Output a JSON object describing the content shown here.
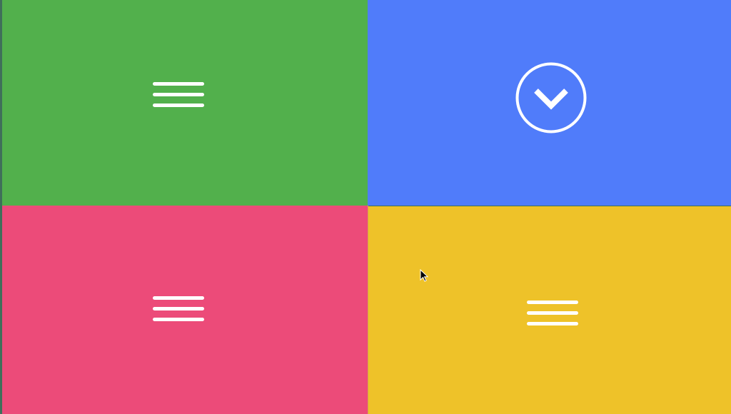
{
  "tiles": [
    {
      "id": "top-left",
      "color": "#52b04c",
      "icon": "hamburger-menu-icon"
    },
    {
      "id": "top-right",
      "color": "#507cfa",
      "icon": "chevron-down-circle-icon"
    },
    {
      "id": "bottom-left",
      "color": "#ec4b79",
      "icon": "hamburger-menu-icon"
    },
    {
      "id": "bottom-right",
      "color": "#eec229",
      "icon": "hamburger-menu-icon"
    }
  ],
  "icon_color": "#ffffff",
  "cursor": {
    "icon": "mouse-pointer-icon"
  }
}
